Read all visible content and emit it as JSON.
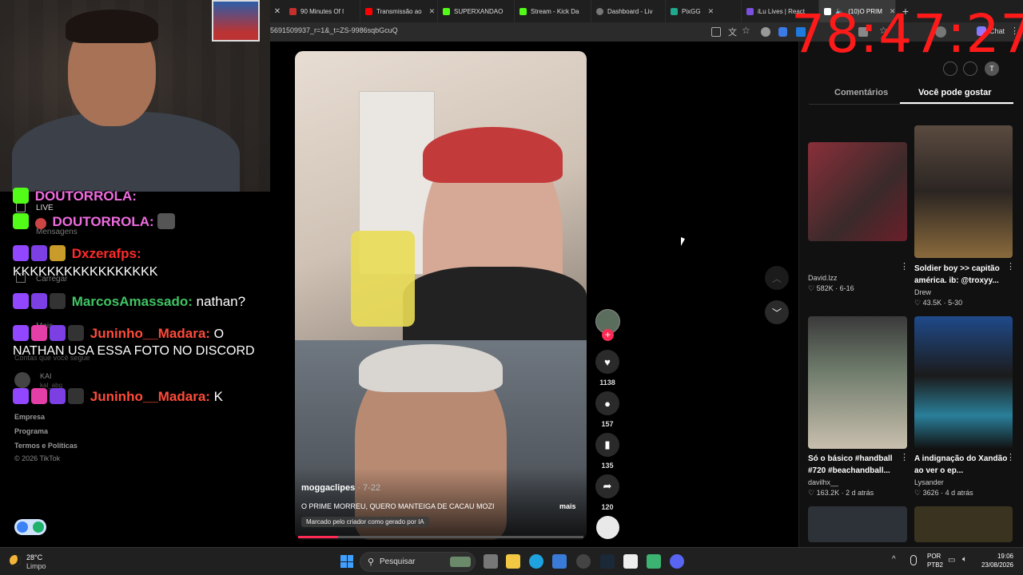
{
  "browser": {
    "tabs": [
      {
        "label": "90 Minutes Of I",
        "icon": "youtube-icon",
        "color": "#ff0000"
      },
      {
        "label": "Transmissão ao",
        "icon": "youtube-icon",
        "color": "#ff0000"
      },
      {
        "label": "SUPERXANDAO",
        "icon": "kick-icon",
        "color": "#53fc18"
      },
      {
        "label": "Stream - Kick Da",
        "icon": "kick-icon",
        "color": "#53fc18"
      },
      {
        "label": "Dashboard - Liv",
        "icon": "globe-icon",
        "color": "#888888"
      },
      {
        "label": "PixGG",
        "icon": "pix-icon",
        "color": "#1fa88c"
      },
      {
        "label": "iLu Lives | React",
        "icon": "ilu-icon",
        "color": "#7b4fe0"
      },
      {
        "label": "(10)O PRIM",
        "icon": "tiktok-icon",
        "color": "#ffffff"
      }
    ],
    "url": "5691509937_r=1&_t=ZS-9986sqbGcuQ",
    "chat_button": "Chat"
  },
  "timer": "78:47:27",
  "tiktok_sidebar": {
    "live": "LIVE",
    "messages": "Mensagens",
    "upload": "Carregar",
    "more": "Mais",
    "following_label": "Contas que você segue",
    "following_user": "KAI",
    "following_handle": "kal_abg",
    "links": [
      "Empresa",
      "Programa",
      "Termos e Políticas"
    ],
    "copyright": "© 2026 TikTok"
  },
  "chat_overlay": [
    {
      "user": "DOUTORROLA:",
      "msg": "",
      "color": "#f06ce0",
      "platform": "kick"
    },
    {
      "user": "Dxzerafps:",
      "msg": "KKKKKKKKKKKKKKKKK",
      "color": "#ff2a2a",
      "platform": "twitch"
    },
    {
      "user": "MarcosAmassado:",
      "msg": "nathan?",
      "color": "#3fc463",
      "platform": "twitch"
    },
    {
      "user": "Juninho__Madara:",
      "msg": "O NATHAN USA ESSA FOTO NO DISCORD",
      "color": "#ff4b3a",
      "platform": "twitch"
    },
    {
      "user": "Juninho__Madara:",
      "msg": "K",
      "color": "#ff4b3a",
      "platform": "twitch"
    }
  ],
  "video": {
    "author": "moggaclipes",
    "date": "7-22",
    "caption": "O PRIME MORREU, QUERO MANTEIGA DE CACAU MOZI",
    "more": "mais",
    "ai_label": "Marcado pelo criador como gerado por IA",
    "progress": 0.14,
    "likes": "1138",
    "comments": "157",
    "saves": "135",
    "shares": "120"
  },
  "right_panel": {
    "tabs": [
      "Comentários",
      "Você pode gostar"
    ],
    "active_tab": 1,
    "cards": [
      {
        "title": "",
        "author": "David.lzz",
        "likes": "582K",
        "date": "6-16"
      },
      {
        "title": "Soldier boy >> capitão américa. ib: @troxyy...",
        "author": "Drew",
        "likes": "43.5K",
        "date": "5-30"
      },
      {
        "title": "Só o básico #handball #720 #beachandball...",
        "author": "davilhx__",
        "likes": "163.2K",
        "date": "2 d atrás"
      },
      {
        "title": "A indignação do Xandão ao ver o ep...",
        "author": "Lysander",
        "likes": "3626",
        "date": "4 d atrás"
      }
    ]
  },
  "taskbar": {
    "weather_temp": "28°C",
    "weather_desc": "Limpo",
    "search": "Pesquisar",
    "lang": "POR",
    "layout": "PTB2",
    "time": "19:06",
    "date": "23/08/2026"
  }
}
